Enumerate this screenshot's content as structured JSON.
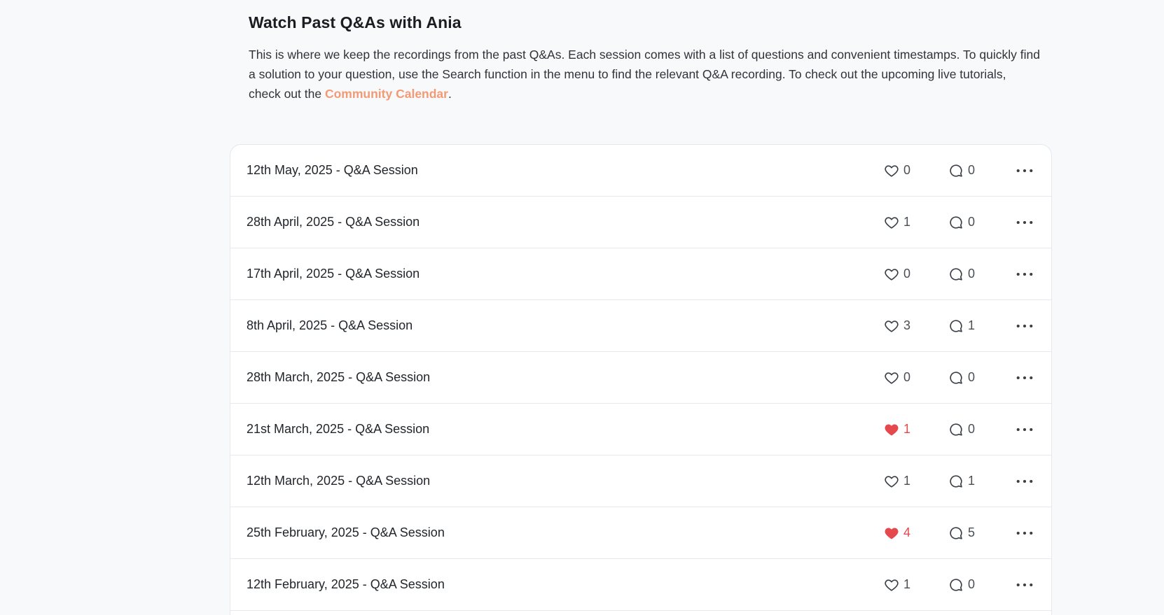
{
  "header": {
    "title": "Watch Past Q&As with Ania",
    "description_before_link": "This is where we keep the recordings from the past Q&As. Each session comes with a list of questions and convenient timestamps. To quickly find a solution to your question, use the Search function in the menu to find the relevant Q&A recording. To check out the upcoming live tutorials, check out the ",
    "link_text": "Community Calendar",
    "description_after_link": "."
  },
  "colors": {
    "accent_link": "#f29a76",
    "liked_heart": "#e5484d",
    "background": "#f8f9fa"
  },
  "icons": {
    "like": "heart-icon",
    "liked": "heart-filled-icon",
    "comment": "comment-bubble-icon",
    "menu": "more-horizontal-icon"
  },
  "sessions": [
    {
      "title": "12th May, 2025 - Q&A Session",
      "likes": "0",
      "comments": "0",
      "liked": false
    },
    {
      "title": "28th April, 2025 - Q&A Session",
      "likes": "1",
      "comments": "0",
      "liked": false
    },
    {
      "title": "17th April, 2025 - Q&A Session",
      "likes": "0",
      "comments": "0",
      "liked": false
    },
    {
      "title": "8th April, 2025 - Q&A Session",
      "likes": "3",
      "comments": "1",
      "liked": false
    },
    {
      "title": "28th March, 2025 - Q&A Session",
      "likes": "0",
      "comments": "0",
      "liked": false
    },
    {
      "title": "21st March, 2025 - Q&A Session",
      "likes": "1",
      "comments": "0",
      "liked": true
    },
    {
      "title": "12th March, 2025 - Q&A Session",
      "likes": "1",
      "comments": "1",
      "liked": false
    },
    {
      "title": "25th February, 2025 - Q&A Session",
      "likes": "4",
      "comments": "5",
      "liked": true
    },
    {
      "title": "12th February, 2025 - Q&A Session",
      "likes": "1",
      "comments": "0",
      "liked": false
    }
  ]
}
